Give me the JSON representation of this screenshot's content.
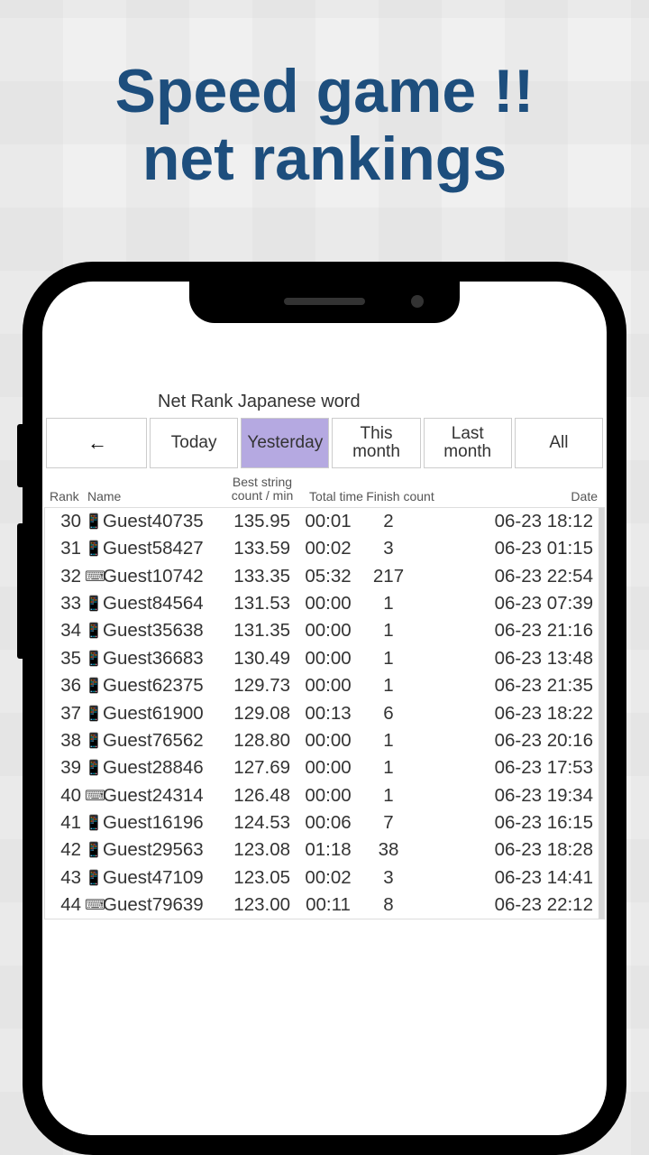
{
  "headline_line1": "Speed game !!",
  "headline_line2": "net rankings",
  "screen_title": "Net Rank Japanese word",
  "back_arrow": "←",
  "tabs": {
    "today": "Today",
    "yesterday": "Yesterday",
    "this_month": "This month",
    "last_month": "Last month",
    "all": "All",
    "active": "yesterday"
  },
  "columns": {
    "rank": "Rank",
    "name": "Name",
    "best": "Best string count / min",
    "total": "Total time",
    "finish": "Finish count",
    "date": "Date"
  },
  "rows": [
    {
      "rank": 30,
      "device": "mobile",
      "name": "Guest40735",
      "best": "135.95",
      "total": "00:01",
      "finish": 2,
      "date": "06-23 18:12"
    },
    {
      "rank": 31,
      "device": "mobile",
      "name": "Guest58427",
      "best": "133.59",
      "total": "00:02",
      "finish": 3,
      "date": "06-23 01:15"
    },
    {
      "rank": 32,
      "device": "desktop",
      "name": "Guest10742",
      "best": "133.35",
      "total": "05:32",
      "finish": 217,
      "date": "06-23 22:54"
    },
    {
      "rank": 33,
      "device": "mobile",
      "name": "Guest84564",
      "best": "131.53",
      "total": "00:00",
      "finish": 1,
      "date": "06-23 07:39"
    },
    {
      "rank": 34,
      "device": "mobile",
      "name": "Guest35638",
      "best": "131.35",
      "total": "00:00",
      "finish": 1,
      "date": "06-23 21:16"
    },
    {
      "rank": 35,
      "device": "mobile",
      "name": "Guest36683",
      "best": "130.49",
      "total": "00:00",
      "finish": 1,
      "date": "06-23 13:48"
    },
    {
      "rank": 36,
      "device": "mobile",
      "name": "Guest62375",
      "best": "129.73",
      "total": "00:00",
      "finish": 1,
      "date": "06-23 21:35"
    },
    {
      "rank": 37,
      "device": "mobile",
      "name": "Guest61900",
      "best": "129.08",
      "total": "00:13",
      "finish": 6,
      "date": "06-23 18:22"
    },
    {
      "rank": 38,
      "device": "mobile",
      "name": "Guest76562",
      "best": "128.80",
      "total": "00:00",
      "finish": 1,
      "date": "06-23 20:16"
    },
    {
      "rank": 39,
      "device": "mobile",
      "name": "Guest28846",
      "best": "127.69",
      "total": "00:00",
      "finish": 1,
      "date": "06-23 17:53"
    },
    {
      "rank": 40,
      "device": "desktop",
      "name": "Guest24314",
      "best": "126.48",
      "total": "00:00",
      "finish": 1,
      "date": "06-23 19:34"
    },
    {
      "rank": 41,
      "device": "mobile",
      "name": "Guest16196",
      "best": "124.53",
      "total": "00:06",
      "finish": 7,
      "date": "06-23 16:15"
    },
    {
      "rank": 42,
      "device": "mobile",
      "name": "Guest29563",
      "best": "123.08",
      "total": "01:18",
      "finish": 38,
      "date": "06-23 18:28"
    },
    {
      "rank": 43,
      "device": "mobile",
      "name": "Guest47109",
      "best": "123.05",
      "total": "00:02",
      "finish": 3,
      "date": "06-23 14:41"
    },
    {
      "rank": 44,
      "device": "desktop",
      "name": "Guest79639",
      "best": "123.00",
      "total": "00:11",
      "finish": 8,
      "date": "06-23 22:12"
    }
  ],
  "icons": {
    "mobile": "📱",
    "desktop": "⌨"
  }
}
